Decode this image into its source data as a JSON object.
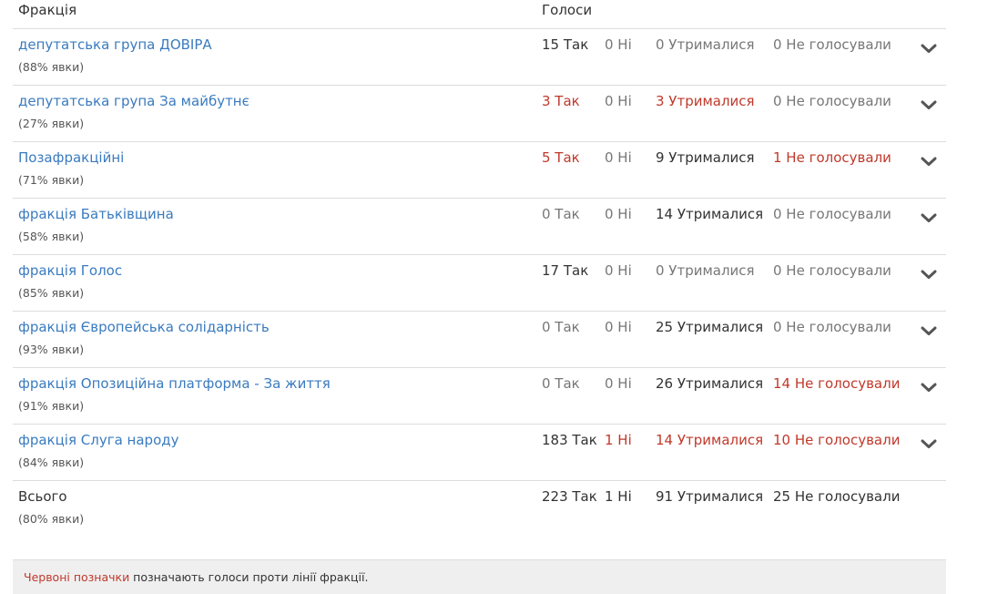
{
  "header": {
    "faction_label": "Фракція",
    "votes_label": "Голоси"
  },
  "colors": {
    "link": "#3a7bbf",
    "red": "#c0392b",
    "muted": "#777777"
  },
  "rows": [
    {
      "name": "депутатська група ДОВІРА",
      "turnout": "(88% явки)",
      "yes": "15 Так",
      "no": "0 Ні",
      "abstained": "0 Утрималися",
      "not_voted": "0 Не голосували",
      "styles": {
        "yes": "dark",
        "no": "muted",
        "abstained": "muted",
        "not_voted": "muted"
      }
    },
    {
      "name": "депутатська група За майбутнє",
      "turnout": "(27% явки)",
      "yes": "3 Так",
      "no": "0 Ні",
      "abstained": "3 Утрималися",
      "not_voted": "0 Не голосували",
      "styles": {
        "yes": "red",
        "no": "muted",
        "abstained": "red",
        "not_voted": "muted"
      }
    },
    {
      "name": "Позафракційні",
      "turnout": "(71% явки)",
      "yes": "5 Так",
      "no": "0 Ні",
      "abstained": "9 Утрималися",
      "not_voted": "1 Не голосували",
      "styles": {
        "yes": "red",
        "no": "muted",
        "abstained": "dark",
        "not_voted": "red"
      }
    },
    {
      "name": "фракція Батьківщина",
      "turnout": "(58% явки)",
      "yes": "0 Так",
      "no": "0 Ні",
      "abstained": "14 Утрималися",
      "not_voted": "0 Не голосували",
      "styles": {
        "yes": "muted",
        "no": "muted",
        "abstained": "dark",
        "not_voted": "muted"
      }
    },
    {
      "name": "фракція Голос",
      "turnout": "(85% явки)",
      "yes": "17 Так",
      "no": "0 Ні",
      "abstained": "0 Утрималися",
      "not_voted": "0 Не голосували",
      "styles": {
        "yes": "dark",
        "no": "muted",
        "abstained": "muted",
        "not_voted": "muted"
      }
    },
    {
      "name": "фракція Європейська солідарність",
      "turnout": "(93% явки)",
      "yes": "0 Так",
      "no": "0 Ні",
      "abstained": "25 Утрималися",
      "not_voted": "0 Не голосували",
      "styles": {
        "yes": "muted",
        "no": "muted",
        "abstained": "dark",
        "not_voted": "muted"
      }
    },
    {
      "name": "фракція Опозиційна платформа - За життя",
      "turnout": "(91% явки)",
      "yes": "0 Так",
      "no": "0 Ні",
      "abstained": "26 Утрималися",
      "not_voted": "14 Не голосували",
      "styles": {
        "yes": "muted",
        "no": "muted",
        "abstained": "dark",
        "not_voted": "red"
      }
    },
    {
      "name": "фракція Слуга народу",
      "turnout": "(84% явки)",
      "yes": "183 Так",
      "no": "1 Ні",
      "abstained": "14 Утрималися",
      "not_voted": "10 Не голосували",
      "styles": {
        "yes": "dark",
        "no": "red",
        "abstained": "red",
        "not_voted": "red"
      }
    }
  ],
  "total": {
    "name": "Всього",
    "turnout": "(80% явки)",
    "yes": "223 Так",
    "no": "1 Ні",
    "abstained": "91 Утрималися",
    "not_voted": "25 Не голосували"
  },
  "note": {
    "highlight": "Червоні позначки",
    "rest": " позначають голоси проти лінії фракції."
  },
  "icons": {
    "expand": "chevron-down-icon"
  }
}
